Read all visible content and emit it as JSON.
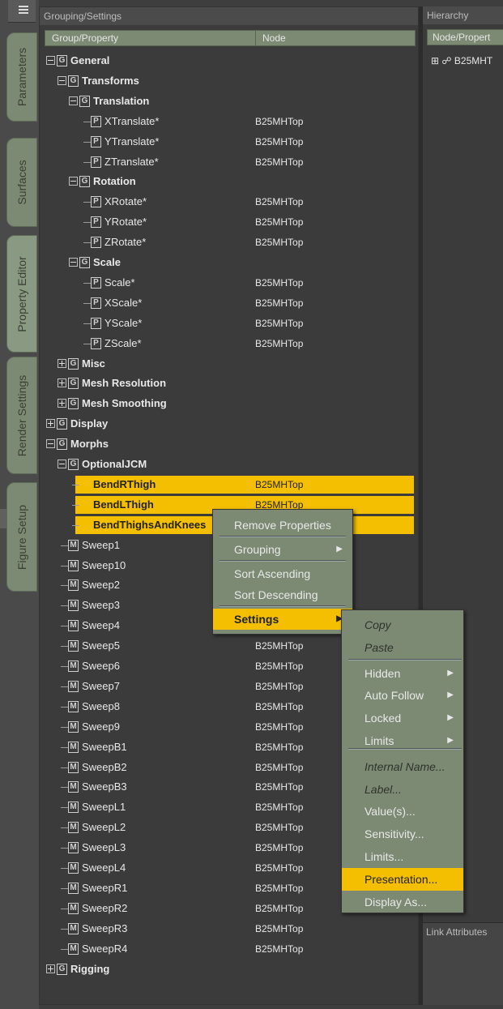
{
  "side_tabs": [
    {
      "label": "Parameters",
      "active": false
    },
    {
      "label": "Surfaces",
      "active": false
    },
    {
      "label": "Property Editor",
      "active": true
    },
    {
      "label": "Render Settings",
      "active": false
    },
    {
      "label": "Figure Setup",
      "active": false
    }
  ],
  "main_panel": {
    "title": "Grouping/Settings",
    "columns": [
      "Group/Property",
      "Node"
    ]
  },
  "tree": [
    {
      "label": "General",
      "type": "G",
      "depth": 0,
      "expanded": true
    },
    {
      "label": "Transforms",
      "type": "G",
      "depth": 1,
      "expanded": true
    },
    {
      "label": "Translation",
      "type": "G",
      "depth": 2,
      "expanded": true
    },
    {
      "label": "XTranslate*",
      "type": "P",
      "depth": 3,
      "node": "B25MHTop"
    },
    {
      "label": "YTranslate*",
      "type": "P",
      "depth": 3,
      "node": "B25MHTop"
    },
    {
      "label": "ZTranslate*",
      "type": "P",
      "depth": 3,
      "node": "B25MHTop"
    },
    {
      "label": "Rotation",
      "type": "G",
      "depth": 2,
      "expanded": true
    },
    {
      "label": "XRotate*",
      "type": "P",
      "depth": 3,
      "node": "B25MHTop"
    },
    {
      "label": "YRotate*",
      "type": "P",
      "depth": 3,
      "node": "B25MHTop"
    },
    {
      "label": "ZRotate*",
      "type": "P",
      "depth": 3,
      "node": "B25MHTop"
    },
    {
      "label": "Scale",
      "type": "G",
      "depth": 2,
      "expanded": true
    },
    {
      "label": "Scale*",
      "type": "P",
      "depth": 3,
      "node": "B25MHTop"
    },
    {
      "label": "XScale*",
      "type": "P",
      "depth": 3,
      "node": "B25MHTop"
    },
    {
      "label": "YScale*",
      "type": "P",
      "depth": 3,
      "node": "B25MHTop"
    },
    {
      "label": "ZScale*",
      "type": "P",
      "depth": 3,
      "node": "B25MHTop"
    },
    {
      "label": "Misc",
      "type": "G",
      "depth": 1,
      "expanded": false
    },
    {
      "label": "Mesh Resolution",
      "type": "G",
      "depth": 1,
      "expanded": false
    },
    {
      "label": "Mesh Smoothing",
      "type": "G",
      "depth": 1,
      "expanded": false
    },
    {
      "label": "Display",
      "type": "G",
      "depth": 0,
      "expanded": false
    },
    {
      "label": "Morphs",
      "type": "G",
      "depth": 0,
      "expanded": true
    },
    {
      "label": "OptionalJCM",
      "type": "G",
      "depth": 1,
      "expanded": true
    },
    {
      "label": "BendRThigh",
      "type": "M",
      "depth": 2,
      "node": "B25MHTop",
      "selected": true
    },
    {
      "label": "BendLThigh",
      "type": "M",
      "depth": 2,
      "node": "B25MHTop",
      "selected": true
    },
    {
      "label": "BendThighsAndKnees",
      "type": "M",
      "depth": 2,
      "node": "",
      "selected": true
    },
    {
      "label": "Sweep1",
      "type": "M",
      "depth": 1,
      "node": ""
    },
    {
      "label": "Sweep10",
      "type": "M",
      "depth": 1,
      "node": ""
    },
    {
      "label": "Sweep2",
      "type": "M",
      "depth": 1,
      "node": ""
    },
    {
      "label": "Sweep3",
      "type": "M",
      "depth": 1,
      "node": ""
    },
    {
      "label": "Sweep4",
      "type": "M",
      "depth": 1,
      "node": ""
    },
    {
      "label": "Sweep5",
      "type": "M",
      "depth": 1,
      "node": "B25MHTop"
    },
    {
      "label": "Sweep6",
      "type": "M",
      "depth": 1,
      "node": "B25MHTop"
    },
    {
      "label": "Sweep7",
      "type": "M",
      "depth": 1,
      "node": "B25MHTop"
    },
    {
      "label": "Sweep8",
      "type": "M",
      "depth": 1,
      "node": "B25MHTop"
    },
    {
      "label": "Sweep9",
      "type": "M",
      "depth": 1,
      "node": "B25MHTop"
    },
    {
      "label": "SweepB1",
      "type": "M",
      "depth": 1,
      "node": "B25MHTop"
    },
    {
      "label": "SweepB2",
      "type": "M",
      "depth": 1,
      "node": "B25MHTop"
    },
    {
      "label": "SweepB3",
      "type": "M",
      "depth": 1,
      "node": "B25MHTop"
    },
    {
      "label": "SweepL1",
      "type": "M",
      "depth": 1,
      "node": "B25MHTop"
    },
    {
      "label": "SweepL2",
      "type": "M",
      "depth": 1,
      "node": "B25MHTop"
    },
    {
      "label": "SweepL3",
      "type": "M",
      "depth": 1,
      "node": "B25MHTop"
    },
    {
      "label": "SweepL4",
      "type": "M",
      "depth": 1,
      "node": "B25MHTop"
    },
    {
      "label": "SweepR1",
      "type": "M",
      "depth": 1,
      "node": "B25MHTop"
    },
    {
      "label": "SweepR2",
      "type": "M",
      "depth": 1,
      "node": "B25MHTop"
    },
    {
      "label": "SweepR3",
      "type": "M",
      "depth": 1,
      "node": "B25MHTop"
    },
    {
      "label": "SweepR4",
      "type": "M",
      "depth": 1,
      "node": "B25MHTop"
    },
    {
      "label": "Rigging",
      "type": "G",
      "depth": 0,
      "expanded": false
    }
  ],
  "hierarchy": {
    "title": "Hierarchy",
    "column": "Node/Propert",
    "item": "B25MHT",
    "bottom_label": "Link Attributes"
  },
  "context_menu": {
    "items": [
      {
        "label": "Remove Properties"
      },
      {
        "label": "Grouping",
        "submenu": true
      },
      {
        "label": "Sort Ascending"
      },
      {
        "label": "Sort Descending"
      },
      {
        "label": "Settings",
        "submenu": true,
        "highlighted": true
      }
    ]
  },
  "settings_submenu": {
    "items": [
      {
        "label": "Copy",
        "style": "italic"
      },
      {
        "label": "Paste",
        "style": "italic"
      },
      {
        "label": "Hidden",
        "submenu": true
      },
      {
        "label": "Auto Follow",
        "submenu": true
      },
      {
        "label": "Locked",
        "submenu": true
      },
      {
        "label": "Limits",
        "submenu": true
      },
      {
        "label": "Internal Name...",
        "style": "italic"
      },
      {
        "label": "Label...",
        "style": "italic"
      },
      {
        "label": "Value(s)..."
      },
      {
        "label": "Sensitivity..."
      },
      {
        "label": "Limits..."
      },
      {
        "label": "Presentation...",
        "highlighted": true
      },
      {
        "label": "Display As..."
      }
    ]
  },
  "colors": {
    "accent": "#f4bf00",
    "tab_green": "#7c8a73",
    "panel_bg": "#3b3b3b"
  }
}
